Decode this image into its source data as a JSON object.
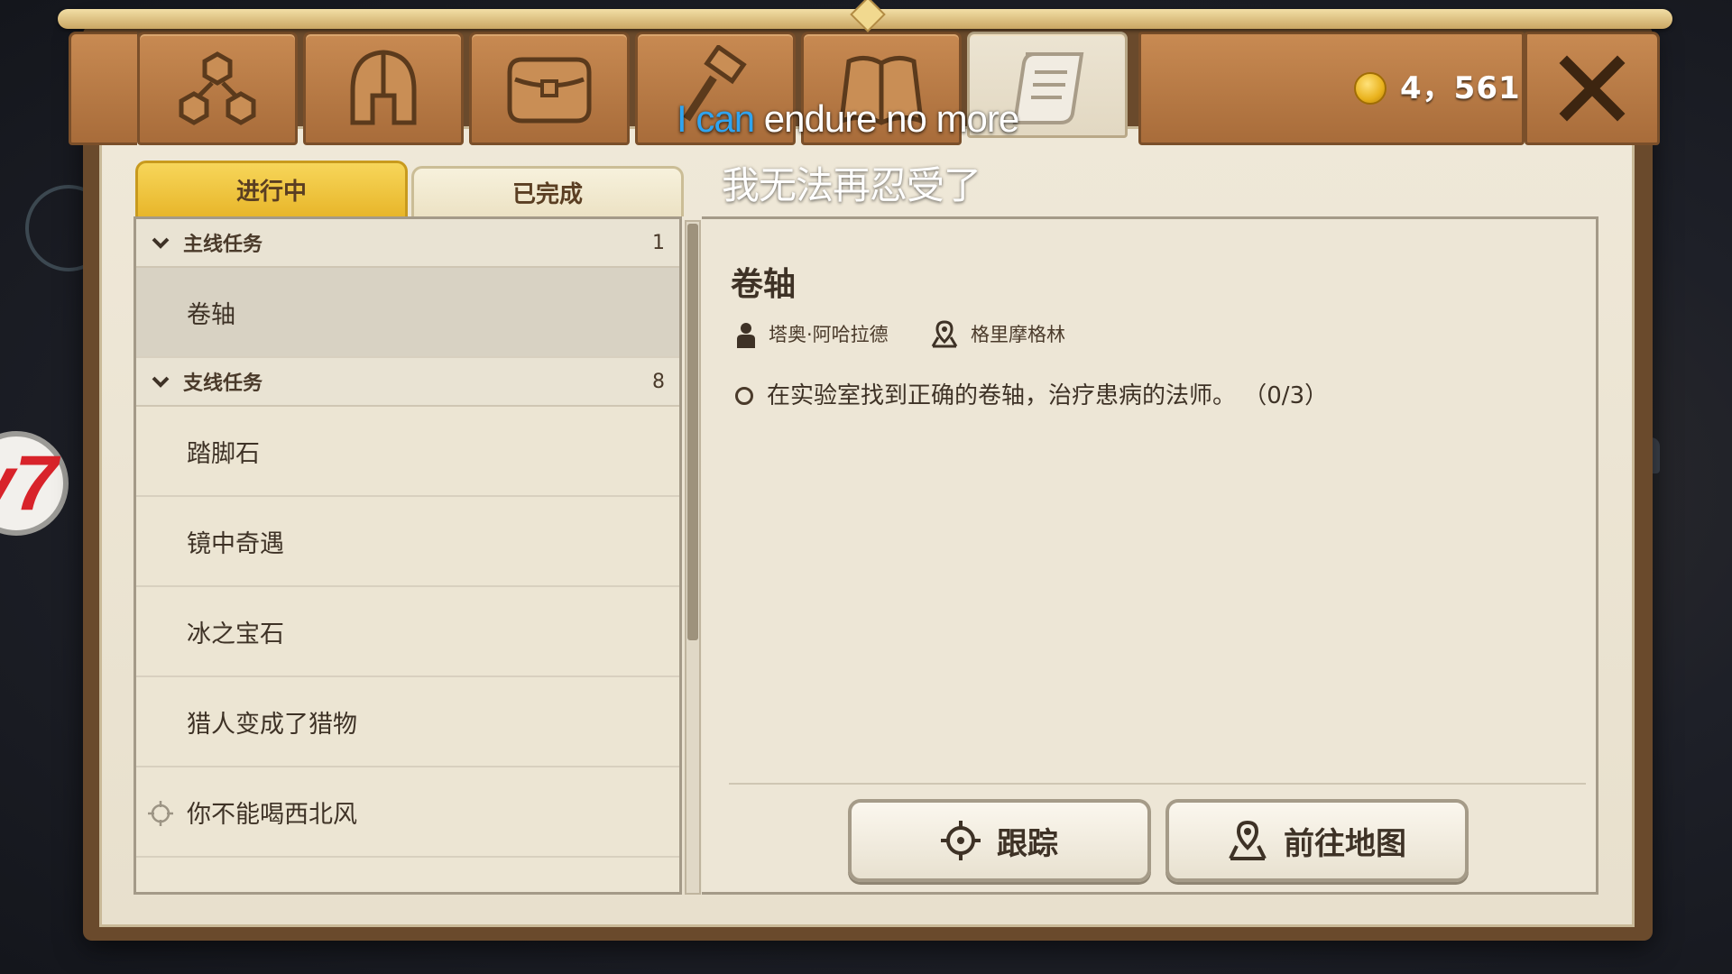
{
  "currency": {
    "amount": "4，561",
    "icon": "gold-coin-icon",
    "color": "#e9b21d"
  },
  "top_tabs": [
    {
      "icon": "skill-tree-icon",
      "active": false
    },
    {
      "icon": "helmet-icon",
      "active": false
    },
    {
      "icon": "chest-icon",
      "active": false
    },
    {
      "icon": "hammer-icon",
      "active": false
    },
    {
      "icon": "book-icon",
      "active": false
    },
    {
      "icon": "scroll-quest-icon",
      "active": true
    }
  ],
  "status_tabs": {
    "in_progress": "进行中",
    "completed": "已完成"
  },
  "quest_list": {
    "main_group": {
      "title": "主线任务",
      "count": "1"
    },
    "main_items": [
      "卷轴"
    ],
    "side_group": {
      "title": "支线任务",
      "count": "8"
    },
    "side_items": [
      "踏脚石",
      "镜中奇遇",
      "冰之宝石",
      "猎人变成了猎物",
      "你不能喝西北风"
    ]
  },
  "quest_detail": {
    "title": "卷轴",
    "npc": "塔奥·阿哈拉德",
    "location": "格里摩格林",
    "objective": "在实验室找到正确的卷轴，治疗患病的法师。 （0/3）"
  },
  "buttons": {
    "track": "跟踪",
    "go_to_map": "前往地图"
  },
  "subtitles": {
    "en_highlight": "I can",
    "en_rest": " endure no more",
    "zh": "我无法再忍受了"
  },
  "colors": {
    "active_tab": "#f0c43c",
    "parchment": "#ece5d3",
    "wood": "#b57842",
    "subtitle_highlight": "#2fa4f0"
  }
}
